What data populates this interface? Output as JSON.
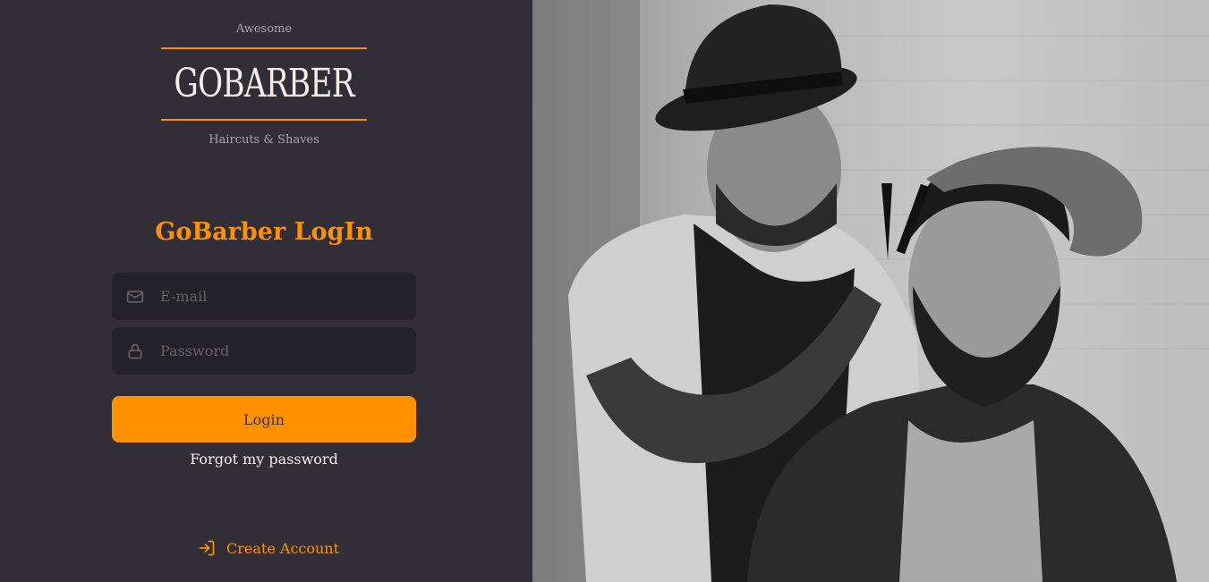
{
  "logo": {
    "top_text": "Awesome",
    "wordmark": "GOBARBER",
    "bottom_text": "Haircuts & Shaves",
    "accent_color": "#ff9000"
  },
  "form": {
    "title": "GoBarber LogIn",
    "email": {
      "placeholder": "E-mail",
      "value": "",
      "icon": "mail-icon"
    },
    "password": {
      "placeholder": "Password",
      "value": "",
      "icon": "lock-icon"
    },
    "login_label": "Login",
    "forgot_label": "Forgot my password"
  },
  "footer": {
    "create_label": "Create Account",
    "icon": "log-in-icon"
  },
  "hero": {
    "image_subject": "barber-photo"
  },
  "colors": {
    "background": "#312e38",
    "input_bg": "#232129",
    "accent": "#ff9000",
    "text": "#f4ede8",
    "muted": "#666360"
  }
}
